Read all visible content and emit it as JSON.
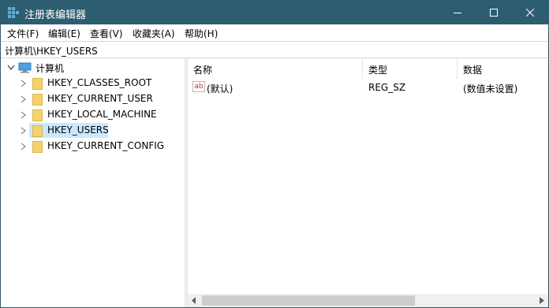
{
  "window": {
    "title": "注册表编辑器",
    "colors": {
      "titlebar": "#2d5d70",
      "selection": "#cce8ff",
      "folder": "#f5d36b"
    }
  },
  "menu": [
    {
      "label": "文件(F)"
    },
    {
      "label": "编辑(E)"
    },
    {
      "label": "查看(V)"
    },
    {
      "label": "收藏夹(A)"
    },
    {
      "label": "帮助(H)"
    }
  ],
  "address": {
    "path": "计算机\\HKEY_USERS"
  },
  "tree": {
    "root": {
      "label": "计算机",
      "icon": "computer-icon",
      "expanded": true
    },
    "items": [
      {
        "label": "HKEY_CLASSES_ROOT",
        "selected": false
      },
      {
        "label": "HKEY_CURRENT_USER",
        "selected": false
      },
      {
        "label": "HKEY_LOCAL_MACHINE",
        "selected": false
      },
      {
        "label": "HKEY_USERS",
        "selected": true
      },
      {
        "label": "HKEY_CURRENT_CONFIG",
        "selected": false
      }
    ]
  },
  "list": {
    "columns": {
      "name": "名称",
      "type": "类型",
      "data": "数据"
    },
    "rows": [
      {
        "name": "(默认)",
        "type": "REG_SZ",
        "data": "(数值未设置)",
        "icon": "string-value-icon",
        "icon_text": "ab"
      }
    ]
  }
}
